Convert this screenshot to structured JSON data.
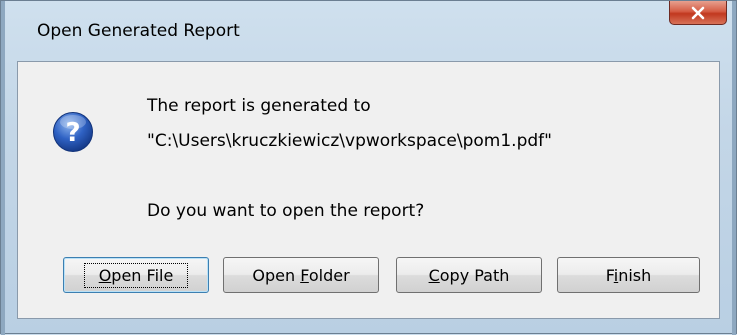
{
  "window": {
    "title": "Open Generated Report"
  },
  "message": {
    "line1": "The report is generated to",
    "line2": "\"C:\\Users\\kruczkiewicz\\vpworkspace\\pom1.pdf\"",
    "line3": "Do you want to open the report?"
  },
  "buttons": {
    "open_file": {
      "mnemonic": "O",
      "rest": "pen File"
    },
    "open_folder": {
      "prefix": "Open ",
      "mnemonic": "F",
      "rest": "older"
    },
    "copy_path": {
      "mnemonic": "C",
      "rest": "opy Path"
    },
    "finish": {
      "prefix": "F",
      "mnemonic": "i",
      "rest": "nish"
    }
  },
  "icons": {
    "close": "close-icon",
    "question": "question-icon"
  }
}
